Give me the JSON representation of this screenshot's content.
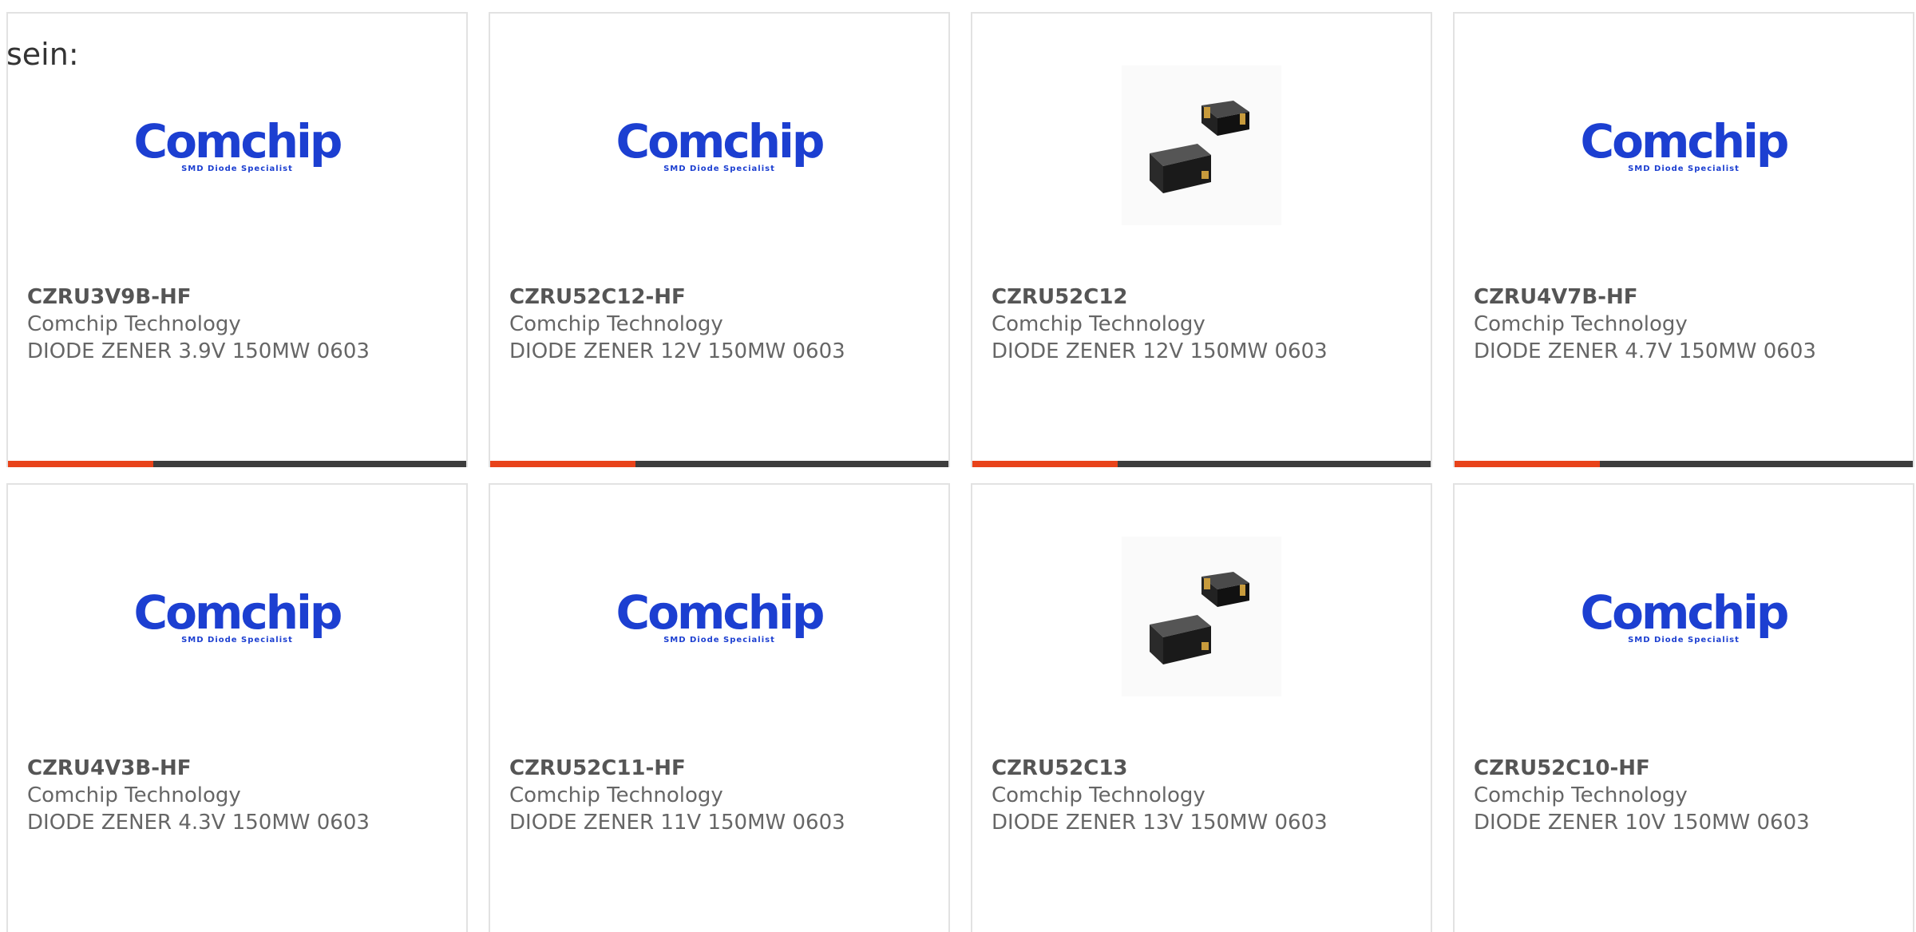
{
  "intro_text": "sein:",
  "colors": {
    "brand_blue": "#1c3fd1",
    "accent_orange": "#e8431a",
    "bar_dark": "#3d3d3d",
    "border": "#e2e2e2",
    "text_gray": "#666666"
  },
  "products": [
    {
      "part_number": "CZRU3V9B-HF",
      "manufacturer": "Comchip Technology",
      "description": "DIODE ZENER 3.9V 150MW 0603",
      "image": "comchip-logo",
      "logo_word": "Comchip",
      "logo_tagline": "SMD Diode Specialist"
    },
    {
      "part_number": "CZRU52C12-HF",
      "manufacturer": "Comchip Technology",
      "description": "DIODE ZENER 12V 150MW 0603",
      "image": "comchip-logo",
      "logo_word": "Comchip",
      "logo_tagline": "SMD Diode Specialist"
    },
    {
      "part_number": "CZRU52C12",
      "manufacturer": "Comchip Technology",
      "description": "DIODE ZENER 12V 150MW 0603",
      "image": "diode-package-photo"
    },
    {
      "part_number": "CZRU4V7B-HF",
      "manufacturer": "Comchip Technology",
      "description": "DIODE ZENER 4.7V 150MW 0603",
      "image": "comchip-logo",
      "logo_word": "Comchip",
      "logo_tagline": "SMD Diode Specialist"
    },
    {
      "part_number": "CZRU4V3B-HF",
      "manufacturer": "Comchip Technology",
      "description": "DIODE ZENER 4.3V 150MW 0603",
      "image": "comchip-logo",
      "logo_word": "Comchip",
      "logo_tagline": "SMD Diode Specialist"
    },
    {
      "part_number": "CZRU52C11-HF",
      "manufacturer": "Comchip Technology",
      "description": "DIODE ZENER 11V 150MW 0603",
      "image": "comchip-logo",
      "logo_word": "Comchip",
      "logo_tagline": "SMD Diode Specialist"
    },
    {
      "part_number": "CZRU52C13",
      "manufacturer": "Comchip Technology",
      "description": "DIODE ZENER 13V 150MW 0603",
      "image": "diode-package-photo"
    },
    {
      "part_number": "CZRU52C10-HF",
      "manufacturer": "Comchip Technology",
      "description": "DIODE ZENER 10V 150MW 0603",
      "image": "comchip-logo",
      "logo_word": "Comchip",
      "logo_tagline": "SMD Diode Specialist"
    }
  ]
}
